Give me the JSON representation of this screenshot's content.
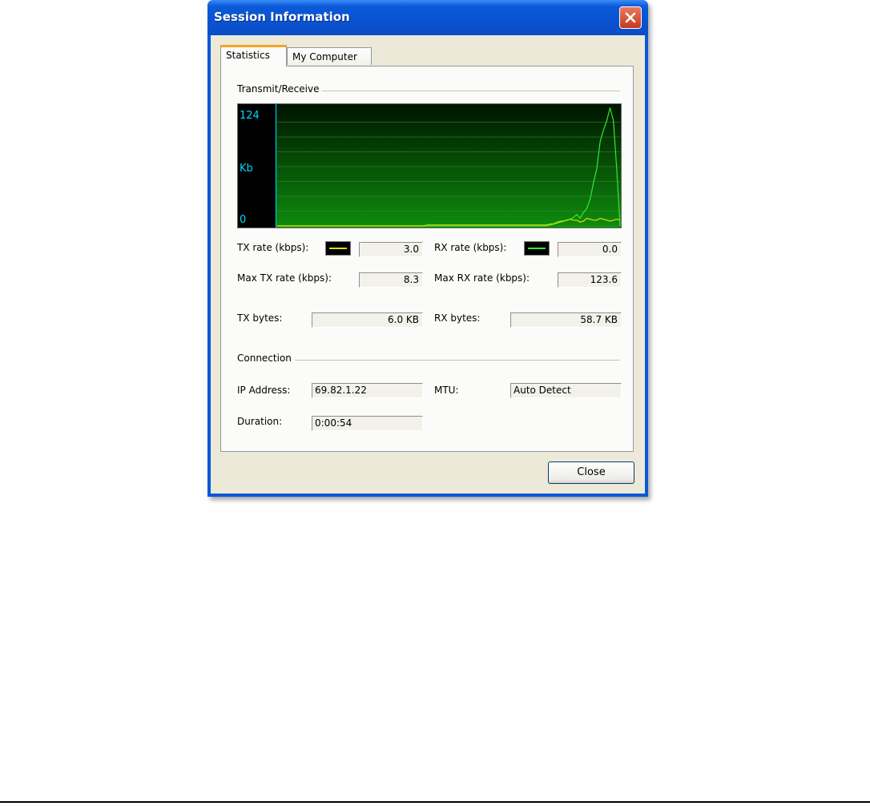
{
  "window": {
    "title": "Session Information"
  },
  "tabs": [
    {
      "label": "Statistics",
      "active": true
    },
    {
      "label": "My Computer",
      "active": false
    }
  ],
  "transmit_receive": {
    "group_label": "Transmit/Receive",
    "graph": {
      "y_max_label": "124",
      "unit_label": "Kb",
      "y_min_label": "0",
      "ylim": [
        0,
        124
      ],
      "tx_color": "#e0e000",
      "rx_color": "#33e833",
      "tx_series": [
        0,
        0,
        0,
        0,
        0,
        0,
        0,
        0,
        0,
        0,
        0,
        0,
        0,
        0,
        0,
        0,
        0,
        0,
        0,
        0,
        0,
        0,
        0,
        0,
        0,
        0,
        0,
        0,
        0,
        0,
        0,
        0,
        0,
        0,
        0,
        0,
        0,
        0,
        0,
        0,
        0,
        0,
        0,
        0,
        0,
        1,
        1,
        1,
        1,
        1,
        1,
        1,
        1,
        1,
        1,
        1,
        1,
        1,
        1,
        1,
        1,
        1,
        1,
        1,
        1,
        1,
        1,
        1,
        1,
        1,
        1,
        1,
        1,
        1,
        1,
        1,
        1,
        1,
        1,
        1,
        1,
        1,
        2,
        2,
        3,
        4,
        5,
        6,
        7,
        6,
        6,
        4,
        5,
        8,
        7,
        6,
        6,
        8,
        7,
        6,
        5,
        6,
        7,
        6
      ],
      "rx_series": [
        0,
        0,
        0,
        0,
        0,
        0,
        0,
        0,
        0,
        0,
        0,
        0,
        0,
        0,
        0,
        0,
        0,
        0,
        0,
        0,
        0,
        0,
        0,
        0,
        0,
        0,
        0,
        0,
        0,
        0,
        0,
        0,
        0,
        0,
        0,
        0,
        0,
        0,
        0,
        0,
        0,
        0,
        0,
        0,
        0,
        0,
        0,
        0,
        0,
        0,
        0,
        0,
        0,
        0,
        0,
        0,
        0,
        0,
        0,
        0,
        0,
        0,
        0,
        0,
        0,
        0,
        0,
        0,
        0,
        0,
        0,
        0,
        0,
        0,
        0,
        0,
        0,
        0,
        0,
        0,
        0,
        0,
        1,
        2,
        4,
        5,
        5,
        6,
        7,
        9,
        12,
        8,
        14,
        18,
        28,
        45,
        60,
        88,
        100,
        110,
        123.6,
        110,
        60,
        0
      ]
    },
    "tx_rate_label": "TX rate (kbps):",
    "tx_rate_value": "3.0",
    "rx_rate_label": "RX rate (kbps):",
    "rx_rate_value": "0.0",
    "max_tx_label": "Max TX rate (kbps):",
    "max_tx_value": "8.3",
    "max_rx_label": "Max RX rate (kbps):",
    "max_rx_value": "123.6",
    "tx_bytes_label": "TX bytes:",
    "tx_bytes_value": "6.0 KB",
    "rx_bytes_label": "RX bytes:",
    "rx_bytes_value": "58.7 KB"
  },
  "connection": {
    "group_label": "Connection",
    "ip_label": "IP Address:",
    "ip_value": "69.82.1.22",
    "mtu_label": "MTU:",
    "mtu_value": "Auto Detect",
    "duration_label": "Duration:",
    "duration_value": "0:00:54"
  },
  "footer": {
    "close_label": "Close"
  }
}
